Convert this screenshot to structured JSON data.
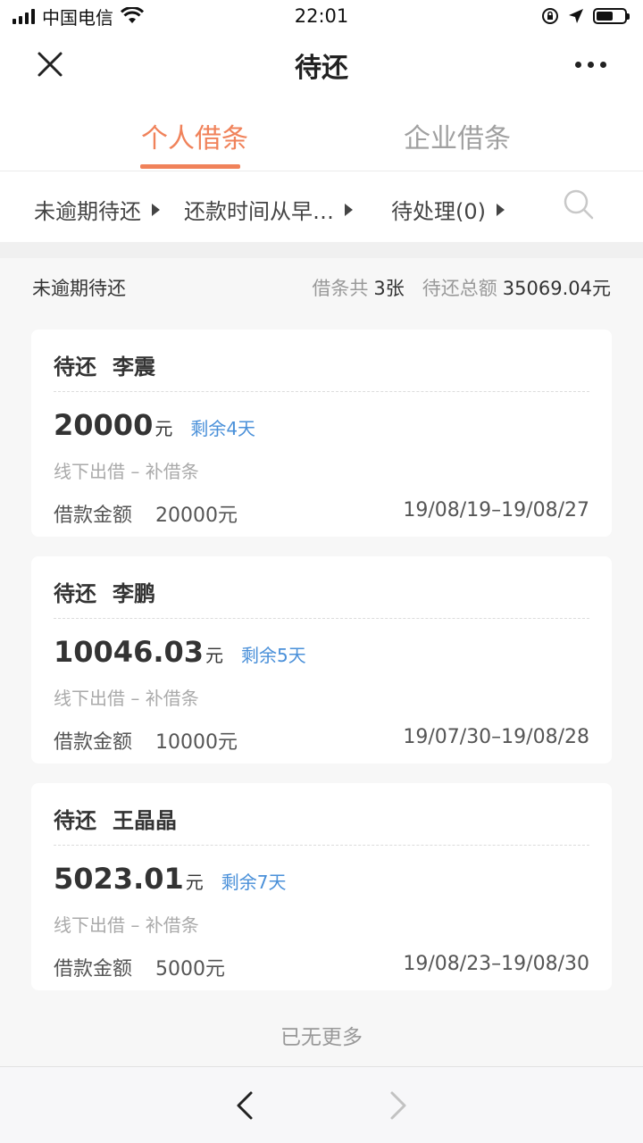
{
  "status_bar": {
    "carrier": "中国电信",
    "time": "22:01",
    "battery_level": 0.6
  },
  "navbar": {
    "title": "待还",
    "close_icon": "close-icon",
    "more_icon": "more-icon"
  },
  "tabs": [
    {
      "label": "个人借条",
      "active": true
    },
    {
      "label": "企业借条",
      "active": false
    }
  ],
  "filters": [
    {
      "label": "未逾期待还"
    },
    {
      "label": "还款时间从早…"
    },
    {
      "label": "待处理(0)"
    }
  ],
  "summary": {
    "label": "未逾期待还",
    "count_label": "借条共",
    "count_value": "3张",
    "total_label": "待还总额",
    "total_value": "35069.04元"
  },
  "cards": [
    {
      "status": "待还",
      "name": "李震",
      "amount": "20000",
      "unit": "元",
      "remaining": "剩余4天",
      "type": "线下出借 – 补借条",
      "loan_label": "借款金额",
      "loan_amount": "20000元",
      "period": "19/08/19–19/08/27"
    },
    {
      "status": "待还",
      "name": "李鹏",
      "amount": "10046.03",
      "unit": "元",
      "remaining": "剩余5天",
      "type": "线下出借 – 补借条",
      "loan_label": "借款金额",
      "loan_amount": "10000元",
      "period": "19/07/30–19/08/28"
    },
    {
      "status": "待还",
      "name": "王晶晶",
      "amount": "5023.01",
      "unit": "元",
      "remaining": "剩余7天",
      "type": "线下出借 – 补借条",
      "loan_label": "借款金额",
      "loan_amount": "5000元",
      "period": "19/08/23–19/08/30"
    }
  ],
  "footer_text": "已无更多",
  "colors": {
    "accent": "#f0825a",
    "link_blue": "#4a90d9",
    "background": "#f7f7f7"
  }
}
